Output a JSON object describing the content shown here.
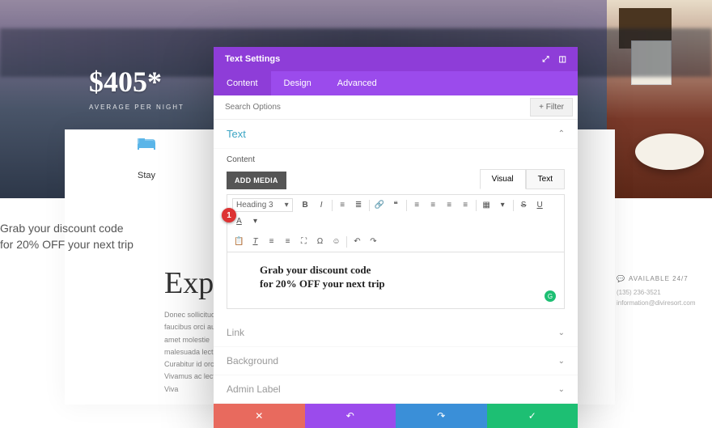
{
  "hero": {
    "price": "$405*",
    "sub": "AVERAGE PER NIGHT"
  },
  "nav": {
    "stay": "Stay"
  },
  "discount": {
    "line1": "Grab your discount code",
    "line2": "for 20% OFF your next trip"
  },
  "exp_heading": "Exp",
  "lorem": "Donec sollicitudin faucibus orci auctor sit amet molestie malesuada lectus. Curabitur id orci porta. Vivamus ac lectus. Viva",
  "contact": {
    "avail": "AVAILABLE 24/7",
    "phone": "(135) 236-3521",
    "email": "information@diviresort.com"
  },
  "modal": {
    "title": "Text Settings",
    "tabs": {
      "content": "Content",
      "design": "Design",
      "advanced": "Advanced"
    },
    "search_placeholder": "Search Options",
    "filter": "Filter",
    "sections": {
      "text": "Text",
      "content_label": "Content",
      "add_media": "ADD MEDIA",
      "link": "Link",
      "background": "Background",
      "admin_label": "Admin Label"
    },
    "editor_tabs": {
      "visual": "Visual",
      "text": "Text"
    },
    "heading_sel": "Heading 3",
    "editor_h3_line1": "Grab your discount code",
    "editor_h3_line2": "for 20% OFF your next trip"
  },
  "marker": "1"
}
